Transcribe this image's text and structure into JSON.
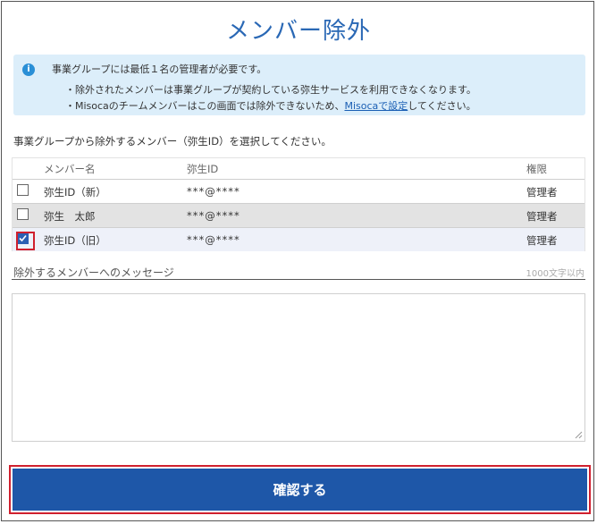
{
  "title": "メンバー除外",
  "info": {
    "icon": "info-icon",
    "line1": "事業グループには最低１名の管理者が必要です。",
    "line2": "・除外されたメンバーは事業グループが契約している弥生サービスを利用できなくなります。",
    "line3_before": "・Misocaのチームメンバーはこの画面では除外できないため、",
    "line3_link": "Misocaで設定",
    "line3_after": "してください。"
  },
  "instruction": "事業グループから除外するメンバー（弥生ID）を選択してください。",
  "table": {
    "headers": {
      "name": "メンバー名",
      "id": "弥生ID",
      "role": "権限"
    },
    "rows": [
      {
        "name": "弥生ID（新）",
        "id": "***@****",
        "role": "管理者",
        "checked": false
      },
      {
        "name": "弥生　太郎",
        "id": "***@****",
        "role": "管理者",
        "checked": false
      },
      {
        "name": "弥生ID（旧）",
        "id": "***@****",
        "role": "管理者",
        "checked": true
      }
    ]
  },
  "message": {
    "label": "除外するメンバーへのメッセージ",
    "limit": "1000文字以内",
    "value": ""
  },
  "confirm_label": "確認する",
  "colors": {
    "accent": "#2a68b5",
    "button": "#1e57a8",
    "highlight": "#d0202e",
    "info_bg": "#dceefa"
  }
}
